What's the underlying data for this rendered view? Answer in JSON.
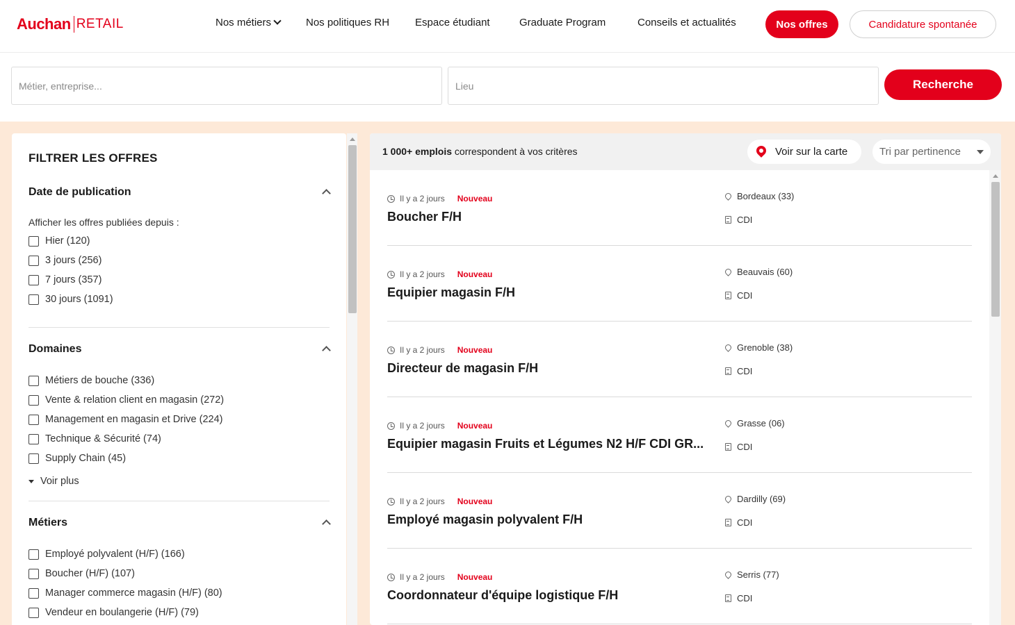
{
  "brand": {
    "name_bold": "Auchan",
    "name_light": "RETAIL",
    "accent": "#e3001b"
  },
  "nav": {
    "items": [
      "Nos métiers",
      "Nos politiques RH",
      "Espace étudiant",
      "Graduate Program",
      "Conseils et actualités"
    ],
    "cta_primary": "Nos offres",
    "cta_secondary": "Candidature spontanée"
  },
  "search": {
    "job_placeholder": "Métier, entreprise...",
    "location_placeholder": "Lieu",
    "submit_label": "Recherche"
  },
  "filters": {
    "title": "FILTRER LES OFFRES",
    "date": {
      "title": "Date de publication",
      "subtitle": "Afficher les offres publiées depuis :",
      "options": [
        "Hier (120)",
        "3 jours (256)",
        "7 jours (357)",
        "30 jours (1091)"
      ]
    },
    "domaines": {
      "title": "Domaines",
      "options": [
        "Métiers de bouche (336)",
        "Vente & relation client en magasin (272)",
        "Management en magasin et Drive (224)",
        "Technique & Sécurité (74)",
        "Supply Chain (45)"
      ],
      "more_label": "Voir plus"
    },
    "metiers": {
      "title": "Métiers",
      "options": [
        "Employé polyvalent (H/F) (166)",
        "Boucher (H/F) (107)",
        "Manager commerce magasin (H/F) (80)",
        "Vendeur en boulangerie (H/F) (79)"
      ]
    }
  },
  "results": {
    "count_strong": "1 000+ emplois",
    "count_rest": " correspondent à vos critères",
    "map_label": "Voir sur la carte",
    "sort_label": "Tri par pertinence",
    "jobs": [
      {
        "posted": "Il y a 2 jours",
        "badge": "Nouveau",
        "title": "Boucher F/H",
        "location": "Bordeaux (33)",
        "contract": "CDI"
      },
      {
        "posted": "Il y a 2 jours",
        "badge": "Nouveau",
        "title": "Equipier magasin F/H",
        "location": "Beauvais (60)",
        "contract": "CDI"
      },
      {
        "posted": "Il y a 2 jours",
        "badge": "Nouveau",
        "title": "Directeur de magasin F/H",
        "location": "Grenoble (38)",
        "contract": "CDI"
      },
      {
        "posted": "Il y a 2 jours",
        "badge": "Nouveau",
        "title": "Equipier magasin Fruits et Légumes N2 H/F CDI GR...",
        "location": "Grasse (06)",
        "contract": "CDI"
      },
      {
        "posted": "Il y a 2 jours",
        "badge": "Nouveau",
        "title": "Employé magasin polyvalent F/H",
        "location": "Dardilly (69)",
        "contract": "CDI"
      },
      {
        "posted": "Il y a 2 jours",
        "badge": "Nouveau",
        "title": "Coordonnateur d'équipe logistique F/H",
        "location": "Serris (77)",
        "contract": "CDI"
      }
    ]
  }
}
